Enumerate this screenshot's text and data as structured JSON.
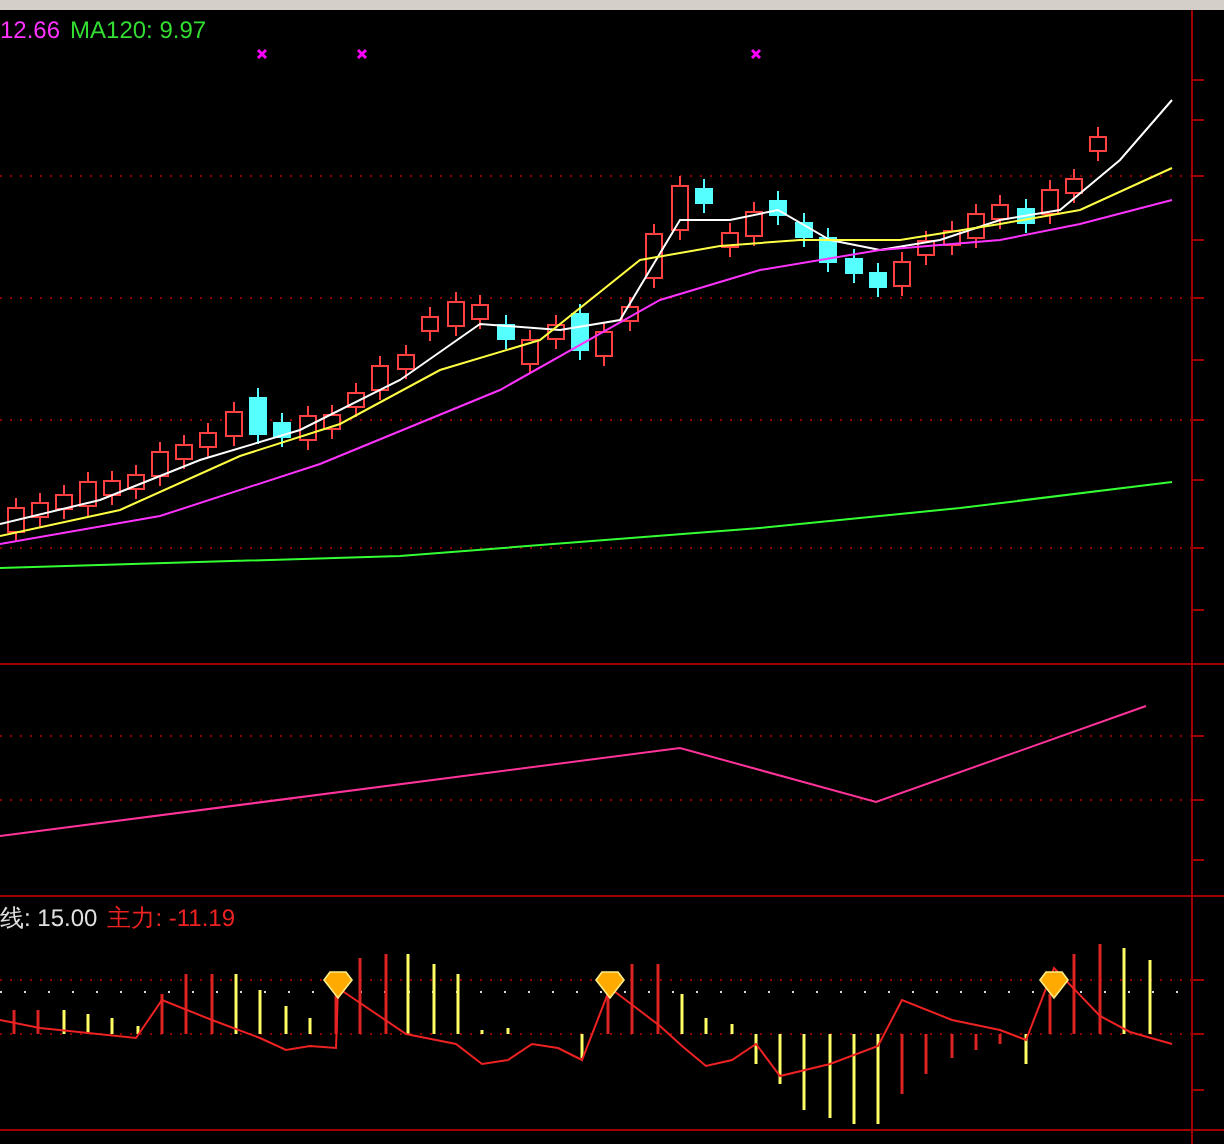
{
  "main_panel": {
    "legend": [
      {
        "text": "12.66",
        "color": "#ff33ff"
      },
      {
        "text": "MA120: 9.97",
        "color": "#33dd33"
      }
    ]
  },
  "indicator_panel": {
    "legend": [
      {
        "text": "线: 15.00",
        "color": "#e0e0e0"
      },
      {
        "text": "主力: -11.19",
        "color": "#ee2222"
      }
    ]
  }
}
